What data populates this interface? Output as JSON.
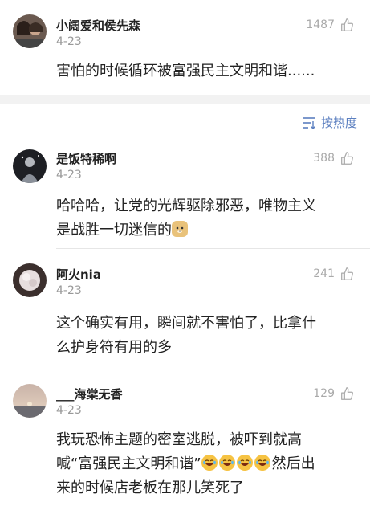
{
  "top_comment": {
    "name": "小阔爱和侯先森",
    "date": "4-23",
    "likes": "1487",
    "text": "害怕的时候循环被富强民主文明和谐......"
  },
  "sort": {
    "label": "按热度"
  },
  "comments": [
    {
      "name": "是饭特稀啊",
      "date": "4-23",
      "likes": "388",
      "text_lines": [
        "哈哈哈，让党的光辉驱除邪恶，唯物主义",
        "是战胜一切迷信的"
      ],
      "emoji": "doge"
    },
    {
      "name": "阿火nia",
      "date": "4-23",
      "likes": "241",
      "text_lines": [
        "这个确实有用，瞬间就不害怕了，比拿什",
        "么护身符有用的多"
      ]
    },
    {
      "name": "___海棠无香",
      "date": "4-23",
      "likes": "129",
      "text_line1": "我玩恐怖主题的密室逃脱，被吓到就高",
      "text_line2_a": "喊“富强民主文明和谐”",
      "text_line2_b": "然后出",
      "text_line3": "来的时候店老板在那儿笑死了",
      "emoji": "laughing-crying"
    }
  ]
}
